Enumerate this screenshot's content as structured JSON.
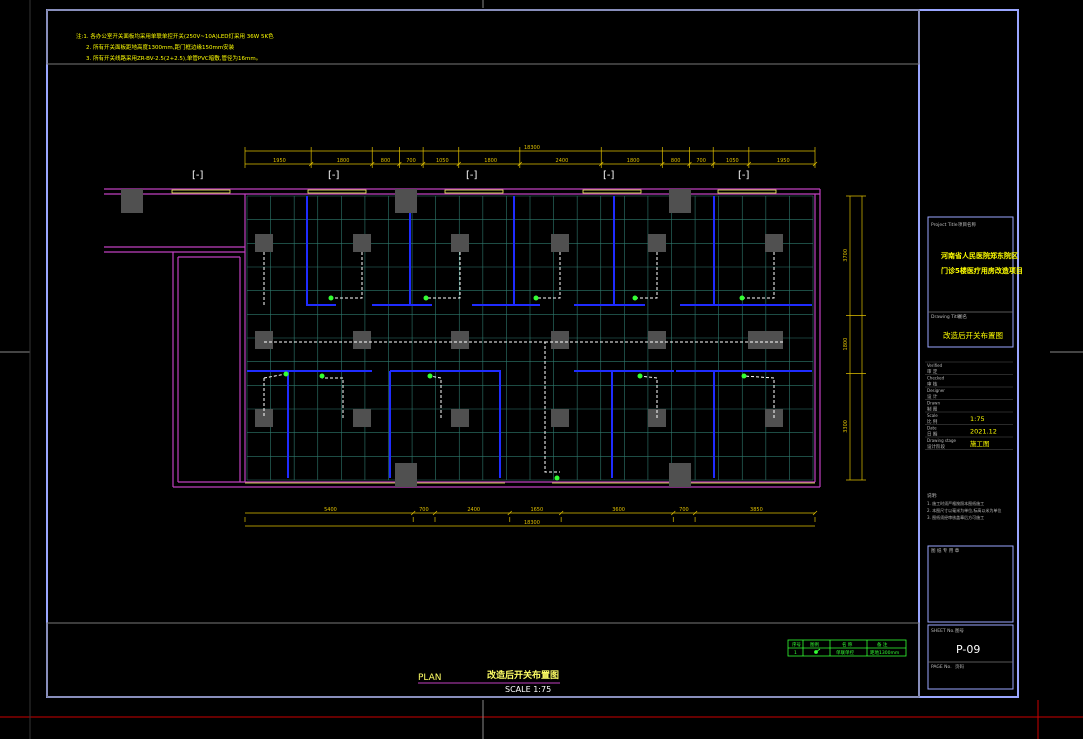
{
  "colors": {
    "background": "#000000",
    "frame": "#9aa6ff",
    "wall": "#c040c0",
    "grid": "#2f7a6e",
    "partition": "#1f2cff",
    "column": "#505050",
    "wire": "#ffffff",
    "switch": "#33ff33",
    "dimension": "#e0c000",
    "window": "#ffff66",
    "titletext": "#ffff00",
    "tablebox": "#33ff33",
    "grey_text": "#bbbbbb",
    "crosshair": "#cc0000"
  },
  "notes": {
    "line1": "注:1. 各办公室开关面板均采用单联单控开关(250V~10A)LED灯采用 36W 5K色",
    "line2": "2. 所有开关面板距地高度1300mm,距门框边缘150mm安装",
    "line3": "3. 所有开关线路采用ZR-BV-2.5(2+2.5),单管PVC暗敷,管径为16mm。"
  },
  "door_markers": [
    "[-]",
    "[-]",
    "[-]",
    "[-]",
    "[-]"
  ],
  "dims": {
    "top_total": "18300",
    "top_segments": [
      "1950",
      "1800",
      "800",
      "700",
      "1050",
      "1800",
      "2400",
      "1800",
      "800",
      "700",
      "1050",
      "1950"
    ],
    "bottom_total": "18300",
    "bottom_segments": [
      "5400",
      "700",
      "2400",
      "1650",
      "3600",
      "700",
      "3850"
    ],
    "right_segments": [
      "3700",
      "1800",
      "3300"
    ]
  },
  "plan": {
    "title": "改造后开关布置图",
    "label": "PLAN",
    "scale": "SCALE 1:75"
  },
  "legend": {
    "headers": [
      "序号",
      "图例",
      "名 称",
      "备 注"
    ],
    "row": [
      "1",
      "",
      "单联单控",
      "距地1300mm"
    ]
  },
  "title_block": {
    "project_title_label": "Project Title",
    "project_title_cn": "项目名称",
    "project_name_line1": "河南省人民医院郑东院区",
    "project_name_line2": "门诊5楼医疗用房改造项目",
    "drawing_title_label": "Drawing Title",
    "drawing_title_cn": "图名",
    "drawing_title": "改造后开关布置图",
    "rows": [
      {
        "en": "Verified",
        "cn": "审 定",
        "value": ""
      },
      {
        "en": "Checked",
        "cn": "审 核",
        "value": ""
      },
      {
        "en": "Designer",
        "cn": "设 计",
        "value": ""
      },
      {
        "en": "Drawn",
        "cn": "制 图",
        "value": ""
      },
      {
        "en": "Scale",
        "cn": "比 例",
        "value": "1:75"
      },
      {
        "en": "Date",
        "cn": "日 期",
        "value": "2021.12"
      },
      {
        "en": "Drawing stage",
        "cn": "设计阶段",
        "value": "施工图"
      }
    ],
    "remarks_title": "说明:",
    "remarks": [
      "1. 施工时须严格按照本图纸施工",
      "2. 本图尺寸以毫米为单位,标高以米为单位",
      "3. 图纸须经审核盖章后方可施工"
    ],
    "stamp_label": "图 纸 专 用 章",
    "sheet_no_label": "SHEET No.",
    "sheet_no_cn": "图号",
    "sheet_no": "P-09",
    "page_label": "PAGE No.",
    "page_cn": "页码"
  }
}
